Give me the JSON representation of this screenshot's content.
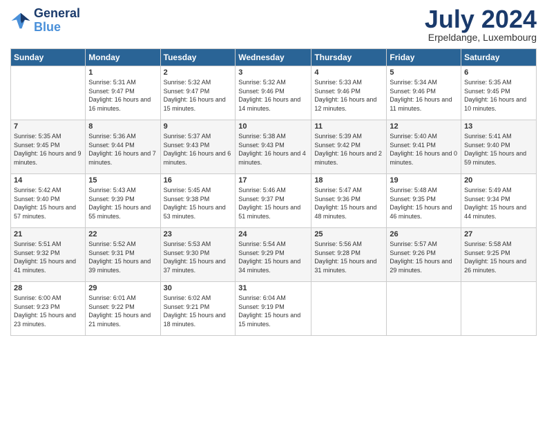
{
  "logo": {
    "line1": "General",
    "line2": "Blue"
  },
  "title": "July 2024",
  "location": "Erpeldange, Luxembourg",
  "headers": [
    "Sunday",
    "Monday",
    "Tuesday",
    "Wednesday",
    "Thursday",
    "Friday",
    "Saturday"
  ],
  "weeks": [
    [
      {
        "day": "",
        "sunrise": "",
        "sunset": "",
        "daylight": ""
      },
      {
        "day": "1",
        "sunrise": "Sunrise: 5:31 AM",
        "sunset": "Sunset: 9:47 PM",
        "daylight": "Daylight: 16 hours and 16 minutes."
      },
      {
        "day": "2",
        "sunrise": "Sunrise: 5:32 AM",
        "sunset": "Sunset: 9:47 PM",
        "daylight": "Daylight: 16 hours and 15 minutes."
      },
      {
        "day": "3",
        "sunrise": "Sunrise: 5:32 AM",
        "sunset": "Sunset: 9:46 PM",
        "daylight": "Daylight: 16 hours and 14 minutes."
      },
      {
        "day": "4",
        "sunrise": "Sunrise: 5:33 AM",
        "sunset": "Sunset: 9:46 PM",
        "daylight": "Daylight: 16 hours and 12 minutes."
      },
      {
        "day": "5",
        "sunrise": "Sunrise: 5:34 AM",
        "sunset": "Sunset: 9:46 PM",
        "daylight": "Daylight: 16 hours and 11 minutes."
      },
      {
        "day": "6",
        "sunrise": "Sunrise: 5:35 AM",
        "sunset": "Sunset: 9:45 PM",
        "daylight": "Daylight: 16 hours and 10 minutes."
      }
    ],
    [
      {
        "day": "7",
        "sunrise": "Sunrise: 5:35 AM",
        "sunset": "Sunset: 9:45 PM",
        "daylight": "Daylight: 16 hours and 9 minutes."
      },
      {
        "day": "8",
        "sunrise": "Sunrise: 5:36 AM",
        "sunset": "Sunset: 9:44 PM",
        "daylight": "Daylight: 16 hours and 7 minutes."
      },
      {
        "day": "9",
        "sunrise": "Sunrise: 5:37 AM",
        "sunset": "Sunset: 9:43 PM",
        "daylight": "Daylight: 16 hours and 6 minutes."
      },
      {
        "day": "10",
        "sunrise": "Sunrise: 5:38 AM",
        "sunset": "Sunset: 9:43 PM",
        "daylight": "Daylight: 16 hours and 4 minutes."
      },
      {
        "day": "11",
        "sunrise": "Sunrise: 5:39 AM",
        "sunset": "Sunset: 9:42 PM",
        "daylight": "Daylight: 16 hours and 2 minutes."
      },
      {
        "day": "12",
        "sunrise": "Sunrise: 5:40 AM",
        "sunset": "Sunset: 9:41 PM",
        "daylight": "Daylight: 16 hours and 0 minutes."
      },
      {
        "day": "13",
        "sunrise": "Sunrise: 5:41 AM",
        "sunset": "Sunset: 9:40 PM",
        "daylight": "Daylight: 15 hours and 59 minutes."
      }
    ],
    [
      {
        "day": "14",
        "sunrise": "Sunrise: 5:42 AM",
        "sunset": "Sunset: 9:40 PM",
        "daylight": "Daylight: 15 hours and 57 minutes."
      },
      {
        "day": "15",
        "sunrise": "Sunrise: 5:43 AM",
        "sunset": "Sunset: 9:39 PM",
        "daylight": "Daylight: 15 hours and 55 minutes."
      },
      {
        "day": "16",
        "sunrise": "Sunrise: 5:45 AM",
        "sunset": "Sunset: 9:38 PM",
        "daylight": "Daylight: 15 hours and 53 minutes."
      },
      {
        "day": "17",
        "sunrise": "Sunrise: 5:46 AM",
        "sunset": "Sunset: 9:37 PM",
        "daylight": "Daylight: 15 hours and 51 minutes."
      },
      {
        "day": "18",
        "sunrise": "Sunrise: 5:47 AM",
        "sunset": "Sunset: 9:36 PM",
        "daylight": "Daylight: 15 hours and 48 minutes."
      },
      {
        "day": "19",
        "sunrise": "Sunrise: 5:48 AM",
        "sunset": "Sunset: 9:35 PM",
        "daylight": "Daylight: 15 hours and 46 minutes."
      },
      {
        "day": "20",
        "sunrise": "Sunrise: 5:49 AM",
        "sunset": "Sunset: 9:34 PM",
        "daylight": "Daylight: 15 hours and 44 minutes."
      }
    ],
    [
      {
        "day": "21",
        "sunrise": "Sunrise: 5:51 AM",
        "sunset": "Sunset: 9:32 PM",
        "daylight": "Daylight: 15 hours and 41 minutes."
      },
      {
        "day": "22",
        "sunrise": "Sunrise: 5:52 AM",
        "sunset": "Sunset: 9:31 PM",
        "daylight": "Daylight: 15 hours and 39 minutes."
      },
      {
        "day": "23",
        "sunrise": "Sunrise: 5:53 AM",
        "sunset": "Sunset: 9:30 PM",
        "daylight": "Daylight: 15 hours and 37 minutes."
      },
      {
        "day": "24",
        "sunrise": "Sunrise: 5:54 AM",
        "sunset": "Sunset: 9:29 PM",
        "daylight": "Daylight: 15 hours and 34 minutes."
      },
      {
        "day": "25",
        "sunrise": "Sunrise: 5:56 AM",
        "sunset": "Sunset: 9:28 PM",
        "daylight": "Daylight: 15 hours and 31 minutes."
      },
      {
        "day": "26",
        "sunrise": "Sunrise: 5:57 AM",
        "sunset": "Sunset: 9:26 PM",
        "daylight": "Daylight: 15 hours and 29 minutes."
      },
      {
        "day": "27",
        "sunrise": "Sunrise: 5:58 AM",
        "sunset": "Sunset: 9:25 PM",
        "daylight": "Daylight: 15 hours and 26 minutes."
      }
    ],
    [
      {
        "day": "28",
        "sunrise": "Sunrise: 6:00 AM",
        "sunset": "Sunset: 9:23 PM",
        "daylight": "Daylight: 15 hours and 23 minutes."
      },
      {
        "day": "29",
        "sunrise": "Sunrise: 6:01 AM",
        "sunset": "Sunset: 9:22 PM",
        "daylight": "Daylight: 15 hours and 21 minutes."
      },
      {
        "day": "30",
        "sunrise": "Sunrise: 6:02 AM",
        "sunset": "Sunset: 9:21 PM",
        "daylight": "Daylight: 15 hours and 18 minutes."
      },
      {
        "day": "31",
        "sunrise": "Sunrise: 6:04 AM",
        "sunset": "Sunset: 9:19 PM",
        "daylight": "Daylight: 15 hours and 15 minutes."
      },
      {
        "day": "",
        "sunrise": "",
        "sunset": "",
        "daylight": ""
      },
      {
        "day": "",
        "sunrise": "",
        "sunset": "",
        "daylight": ""
      },
      {
        "day": "",
        "sunrise": "",
        "sunset": "",
        "daylight": ""
      }
    ]
  ]
}
